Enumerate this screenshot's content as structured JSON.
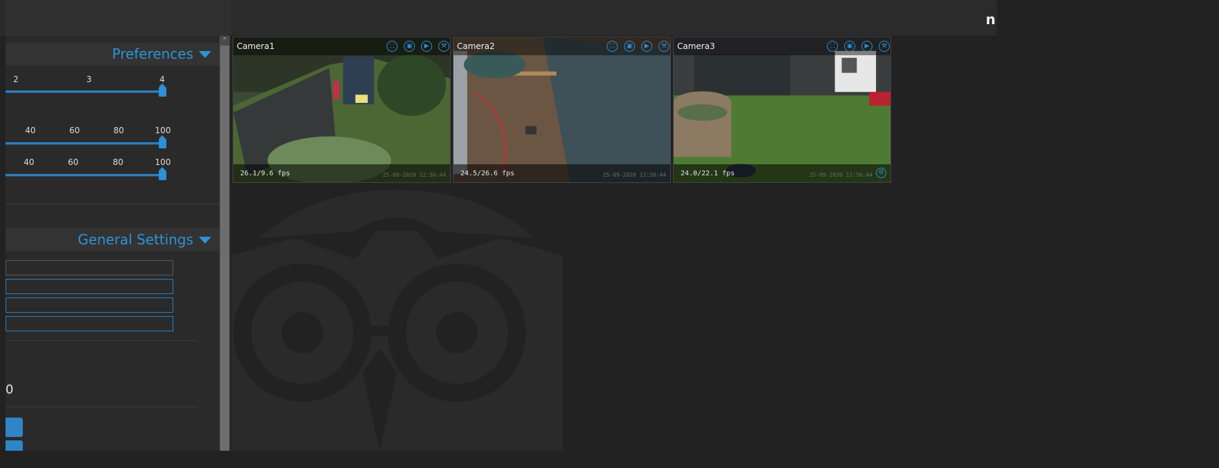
{
  "header": {
    "logo_text": "n"
  },
  "sidebar": {
    "preferences": {
      "title": "Preferences",
      "slider1": {
        "ticks": [
          "2",
          "3",
          "4"
        ],
        "value": 4
      },
      "slider2": {
        "ticks": [
          "40",
          "60",
          "80",
          "100"
        ],
        "value": 100
      },
      "slider3": {
        "ticks": [
          "40",
          "60",
          "80",
          "100"
        ],
        "value": 100
      }
    },
    "general_settings": {
      "title": "General Settings",
      "fields": [
        "",
        "",
        "",
        ""
      ],
      "partial_value": "0"
    }
  },
  "cameras": [
    {
      "name": "Camera1",
      "fps": "26.1/9.6 fps",
      "timestamp": "25-09-2020 12:56:44"
    },
    {
      "name": "Camera2",
      "fps": "24.5/26.6 fps",
      "timestamp": "25-09-2020 12:56:44"
    },
    {
      "name": "Camera3",
      "fps": "24.0/22.1 fps",
      "timestamp": "25-09-2020 12:56:44"
    }
  ],
  "icons": {
    "camera_toolbar": [
      "fullscreen-icon",
      "snapshot-icon",
      "play-icon",
      "settings-icon"
    ],
    "camera3_footer": "settings-icon"
  },
  "colors": {
    "accent": "#2e93d6",
    "background": "#222222",
    "panel": "#2a2a2a"
  }
}
